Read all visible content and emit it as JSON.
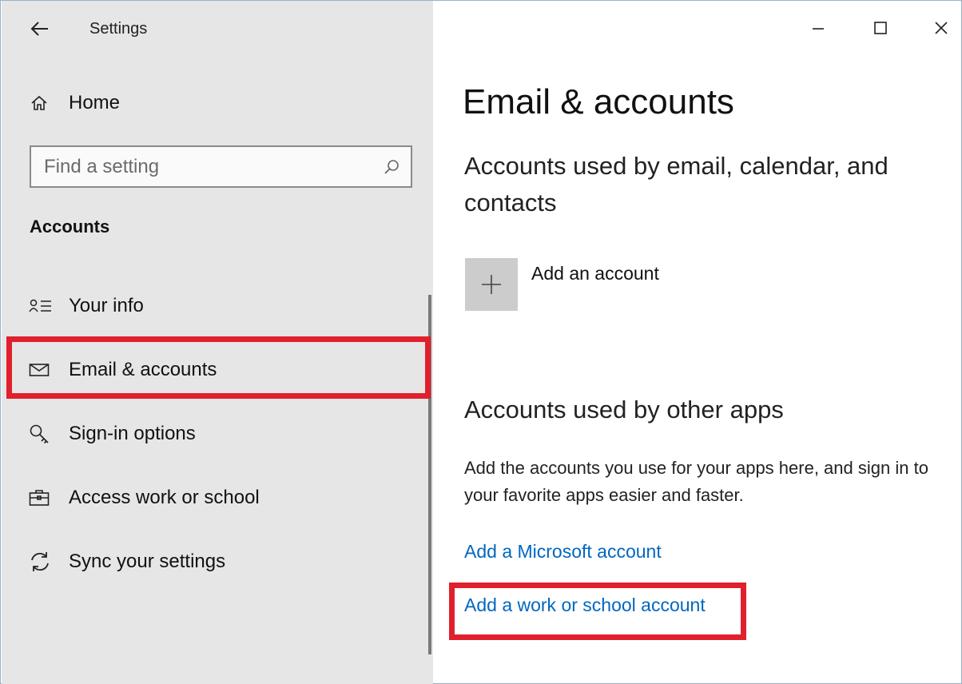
{
  "window": {
    "app_title": "Settings",
    "controls": [
      "minimize",
      "maximize",
      "close"
    ]
  },
  "sidebar": {
    "home_label": "Home",
    "search": {
      "placeholder": "Find a setting",
      "value": ""
    },
    "section_label": "Accounts",
    "items": [
      {
        "label": "Your info",
        "icon": "person-list-icon",
        "selected": false
      },
      {
        "label": "Email & accounts",
        "icon": "mail-icon",
        "selected": true
      },
      {
        "label": "Sign-in options",
        "icon": "key-icon",
        "selected": false
      },
      {
        "label": "Access work or school",
        "icon": "briefcase-icon",
        "selected": false
      },
      {
        "label": "Sync your settings",
        "icon": "sync-icon",
        "selected": false
      }
    ]
  },
  "main": {
    "title": "Email & accounts",
    "email_section": {
      "heading": "Accounts used by email, calendar, and contacts",
      "add_account_label": "Add an account"
    },
    "other_apps_section": {
      "heading": "Accounts used by other apps",
      "description": "Add the accounts you use for your apps here, and sign in to your favorite apps easier and faster.",
      "links": [
        "Add a Microsoft account",
        "Add a work or school account"
      ]
    }
  },
  "colors": {
    "sidebar_bg": "#e6e6e6",
    "link": "#0067c0",
    "highlight": "#e0202c",
    "tile": "#cccccc"
  }
}
